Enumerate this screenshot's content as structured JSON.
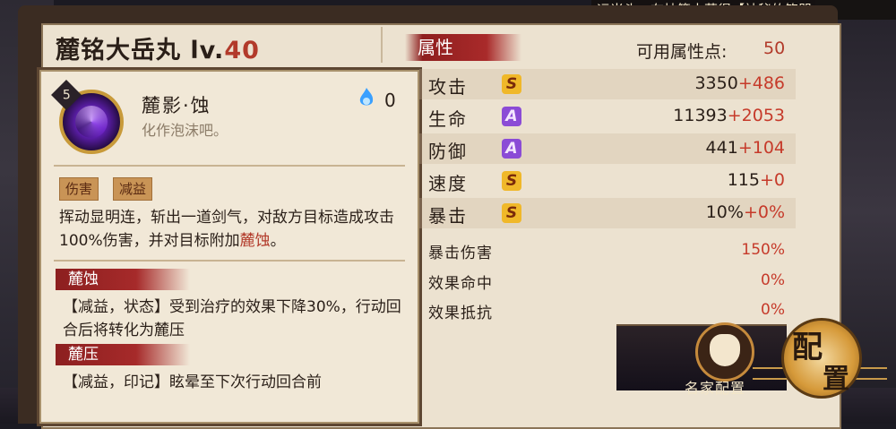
{
  "marquee": "运当头，在抽签中获得【神秘的符咒",
  "character": {
    "name": "麓铭大岳丸",
    "level_prefix": "lv.",
    "level": "40"
  },
  "skill": {
    "cost": "5",
    "name": "麓影·蚀",
    "subtitle": "化作泡沫吧。",
    "orb_count": "0",
    "tags": [
      "伤害",
      "减益"
    ],
    "desc_main": "挥动显明连，斩出一道剑气，对敌方目标造成攻击100%伤害，并对目标附加",
    "desc_highlight": "麓蚀",
    "desc_end": "。",
    "effects": [
      {
        "title": "麓蚀",
        "desc": "【减益，状态】受到治疗的效果下降30%，行动回合后将转化为麓压"
      },
      {
        "title": "麓压",
        "desc": "【减益，印记】眩晕至下次行动回合前"
      }
    ]
  },
  "attributes": {
    "banner": "属性",
    "points_label": "可用属性点:",
    "points_value": "50",
    "main": [
      {
        "label": "攻击",
        "grade": "S",
        "base": "3350",
        "bonus": "+486"
      },
      {
        "label": "生命",
        "grade": "A",
        "base": "11393",
        "bonus": "+2053"
      },
      {
        "label": "防御",
        "grade": "A",
        "base": "441",
        "bonus": "+104"
      },
      {
        "label": "速度",
        "grade": "S",
        "base": "115",
        "bonus": "+0"
      },
      {
        "label": "暴击",
        "grade": "S",
        "base": "10%",
        "bonus": "+0%"
      }
    ],
    "secondary": [
      {
        "label": "暴击伤害",
        "value": "150%"
      },
      {
        "label": "效果命中",
        "value": "0%"
      },
      {
        "label": "效果抵抗",
        "value": "0%"
      }
    ]
  },
  "buttons": {
    "preset_label": "名家配置",
    "config_char1": "配",
    "config_char2": "置"
  },
  "colors": {
    "accent_red": "#b23a2a",
    "grade_s": "#f0b829",
    "grade_a": "#8b4bd6"
  },
  "icons": {
    "orb": "blue-flame-orb-icon",
    "preset": "fox-mask-icon"
  }
}
